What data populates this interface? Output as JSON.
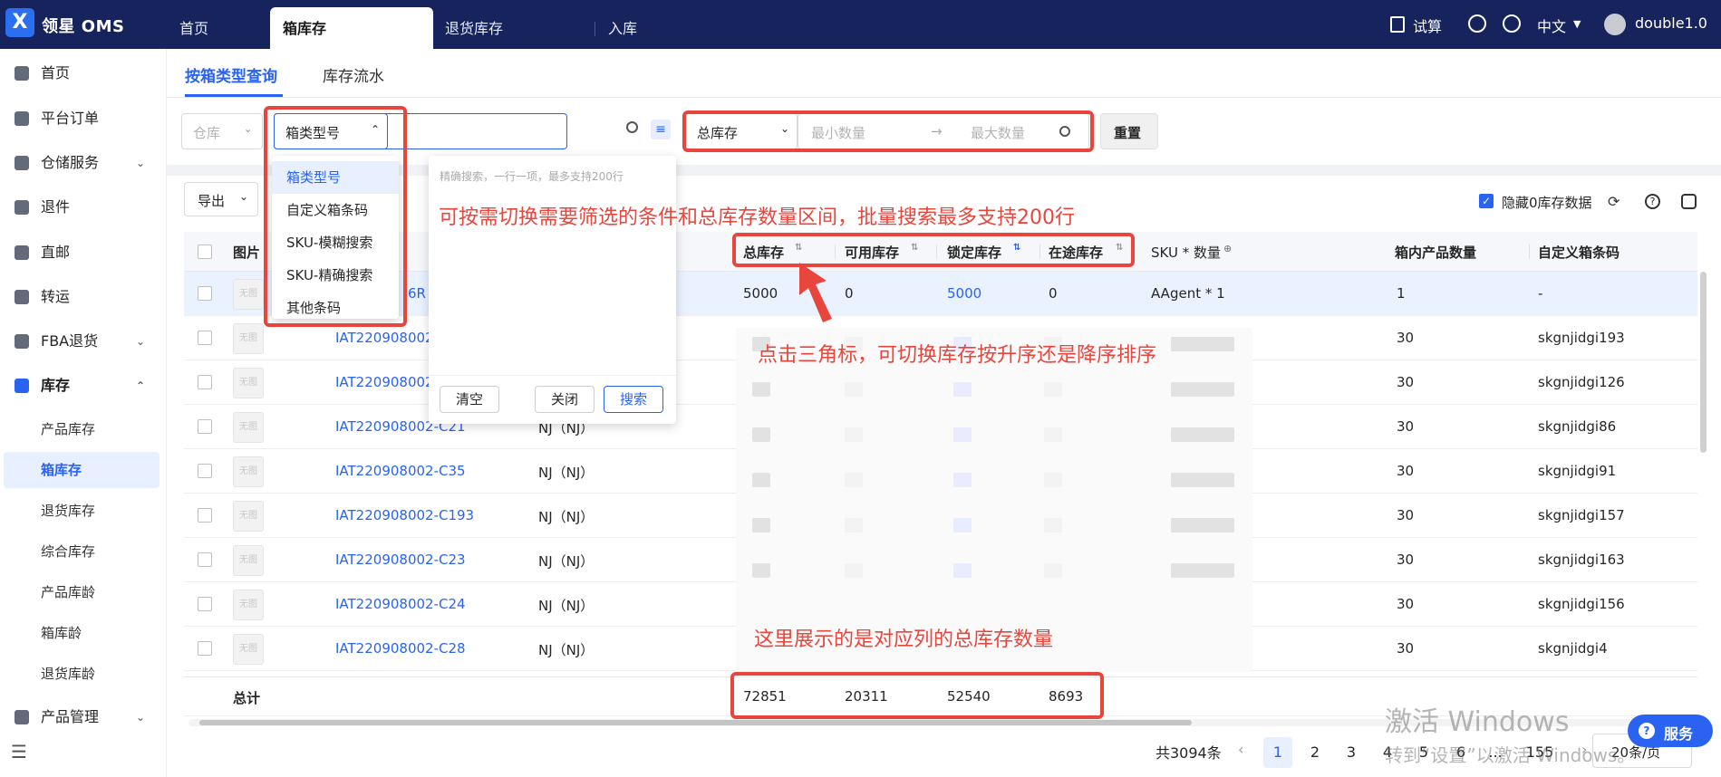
{
  "app": {
    "logo_glyph": "X",
    "title": "领星 OMS"
  },
  "top_tabs": [
    {
      "label": "首页"
    },
    {
      "label": "箱库存"
    },
    {
      "label": "退货库存"
    },
    {
      "label": "入库"
    }
  ],
  "top_right": {
    "trial_label": "试算",
    "language": "中文",
    "user": "double1.0"
  },
  "sidebar": {
    "items": [
      {
        "label": "首页",
        "icon": "home-icon"
      },
      {
        "label": "平台订单",
        "icon": "order-icon"
      },
      {
        "label": "仓储服务",
        "icon": "warehouse-icon",
        "chevron": "⌄"
      },
      {
        "label": "退件",
        "icon": "return-icon"
      },
      {
        "label": "直邮",
        "icon": "mail-icon"
      },
      {
        "label": "转运",
        "icon": "transfer-icon"
      },
      {
        "label": "FBA退货",
        "icon": "fba-icon",
        "chevron": "⌄"
      },
      {
        "label": "库存",
        "icon": "inventory-icon",
        "chevron": "⌃"
      }
    ],
    "sub_items": [
      {
        "label": "产品库存"
      },
      {
        "label": "箱库存"
      },
      {
        "label": "退货库存"
      },
      {
        "label": "综合库存"
      },
      {
        "label": "产品库龄"
      },
      {
        "label": "箱库龄"
      },
      {
        "label": "退货库龄"
      }
    ],
    "product_mgmt": {
      "label": "产品管理",
      "chevron": "⌄"
    }
  },
  "sub_tabs": [
    {
      "label": "按箱类型查询"
    },
    {
      "label": "库存流水"
    }
  ],
  "filters": {
    "warehouse_placeholder": "仓库",
    "box_type_select": "箱类型号",
    "stock_select": "总库存",
    "min_placeholder": "最小数量",
    "max_placeholder": "最大数量",
    "reset_label": "重置"
  },
  "toolbar": {
    "export_label": "导出",
    "hide_zero_label": "隐藏0库存数据"
  },
  "dropdown": {
    "options": [
      "箱类型号",
      "自定义箱条码",
      "SKU-模糊搜索",
      "SKU-精确搜索",
      "其他条码"
    ]
  },
  "batch_panel": {
    "hint": "精确搜索，一行一项，最多支持200行",
    "clear_label": "清空",
    "close_label": "关闭",
    "search_label": "搜索"
  },
  "table": {
    "headers": {
      "image": "图片",
      "total": "总库存",
      "available": "可用库存",
      "locked": "锁定库存",
      "in_transit": "在途库存",
      "sku_qty": "SKU * 数量",
      "box_qty": "箱内产品数量",
      "custom_code": "自定义箱条码"
    },
    "noimg_label": "无图",
    "rows": [
      {
        "box": "6R",
        "wh": "",
        "total": "5000",
        "avail": "0",
        "locked": "5000",
        "transit": "0",
        "sku": "AAgent * 1",
        "qty": "1",
        "code": "-"
      },
      {
        "box": "IAT220908002-",
        "wh": "",
        "qty": "30",
        "code": "skgnjidgi193"
      },
      {
        "box": "IAT220908002-",
        "wh": "",
        "qty": "30",
        "code": "skgnjidgi126"
      },
      {
        "box": "IAT220908002-C21",
        "wh": "NJ（NJ）",
        "qty": "30",
        "code": "skgnjidgi86"
      },
      {
        "box": "IAT220908002-C35",
        "wh": "NJ（NJ）",
        "qty": "30",
        "code": "skgnjidgi91"
      },
      {
        "box": "IAT220908002-C193",
        "wh": "NJ（NJ）",
        "qty": "30",
        "code": "skgnjidgi157"
      },
      {
        "box": "IAT220908002-C23",
        "wh": "NJ（NJ）",
        "qty": "30",
        "code": "skgnjidgi163"
      },
      {
        "box": "IAT220908002-C24",
        "wh": "NJ（NJ）",
        "qty": "30",
        "code": "skgnjidgi156"
      },
      {
        "box": "IAT220908002-C28",
        "wh": "NJ（NJ）",
        "qty": "30",
        "code": "skgnjidgi4"
      }
    ],
    "totals": {
      "label": "总计",
      "total": "72851",
      "available": "20311",
      "locked": "52540",
      "in_transit": "8693"
    }
  },
  "annotations": {
    "filter_tip": "可按需切换需要筛选的条件和总库存数量区间，批量搜索最多支持200行",
    "sort_tip": "点击三角标，可切换库存按升序还是降序排序",
    "total_tip": "这里展示的是对应列的总库存数量"
  },
  "pagination": {
    "total_text": "共3094条",
    "pages": [
      "1",
      "2",
      "3",
      "4",
      "5",
      "6",
      "...",
      "155"
    ],
    "page_size": "20条/页"
  },
  "watermark": {
    "line1": "激活 Windows",
    "line2": "转到“设置”以激活 Windows。"
  },
  "service_label": "服务",
  "colors": {
    "topbar": "#16235d",
    "accent": "#2a63f2",
    "annotation": "#e8453c"
  }
}
